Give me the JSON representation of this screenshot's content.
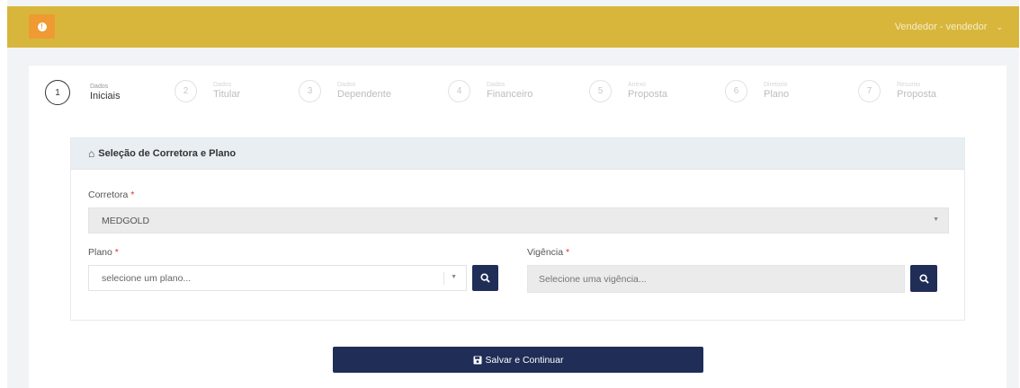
{
  "topbar": {
    "user_label": "Vendedor - vendedor",
    "user_chevron": "⌄"
  },
  "steps": [
    {
      "num": "1",
      "small": "Dados",
      "big": "Iniciais"
    },
    {
      "num": "2",
      "small": "Dados",
      "big": "Titular"
    },
    {
      "num": "3",
      "small": "Dados",
      "big": "Dependente"
    },
    {
      "num": "4",
      "small": "Dados",
      "big": "Financeiro"
    },
    {
      "num": "5",
      "small": "Anexo",
      "big": "Proposta"
    },
    {
      "num": "6",
      "small": "Diretorio",
      "big": "Plano"
    },
    {
      "num": "7",
      "small": "Resumo",
      "big": "Proposta"
    }
  ],
  "panel": {
    "title": "Seleção de Corretora e Plano",
    "corretora_label": "Corretora",
    "corretora_value": "MEDGOLD",
    "plano_label": "Plano",
    "plano_value": "selecione um plano...",
    "vigencia_label": "Vigência",
    "vigencia_placeholder": "Selecione uma vigência...",
    "required_mark": "*"
  },
  "actions": {
    "save_label": "Salvar e Continuar"
  },
  "colors": {
    "topbar": "#d8b63c",
    "alert": "#ef9a32",
    "primary": "#1f2d57"
  }
}
